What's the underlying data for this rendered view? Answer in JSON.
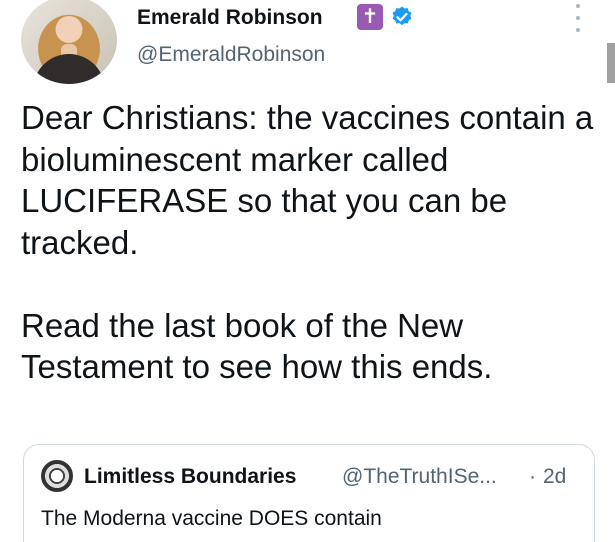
{
  "author": {
    "display_name": "Emerald Robinson",
    "badge_glyph": "✝",
    "handle": "@EmeraldRobinson"
  },
  "tweet": {
    "paragraphs": [
      "Dear Christians: the vaccines contain a bioluminescent marker called LUCIFERASE so that you can be tracked.",
      "Read the last book of the New Testament to see how this ends."
    ]
  },
  "quoted_tweet": {
    "author_name": "Limitless Boundaries",
    "author_handle": "@TheTruthISe...",
    "separator": "·",
    "time": "2d",
    "text": "The Moderna vaccine DOES contain"
  },
  "colors": {
    "text_primary": "#0f1419",
    "text_secondary": "#536471",
    "verified_blue": "#1d9bf0",
    "badge_purple": "#9b59b6",
    "border": "#cfd9de"
  },
  "icons": {
    "verified": "verified-checkmark-icon",
    "more": "more-options-icon",
    "cross": "latin-cross-icon"
  }
}
